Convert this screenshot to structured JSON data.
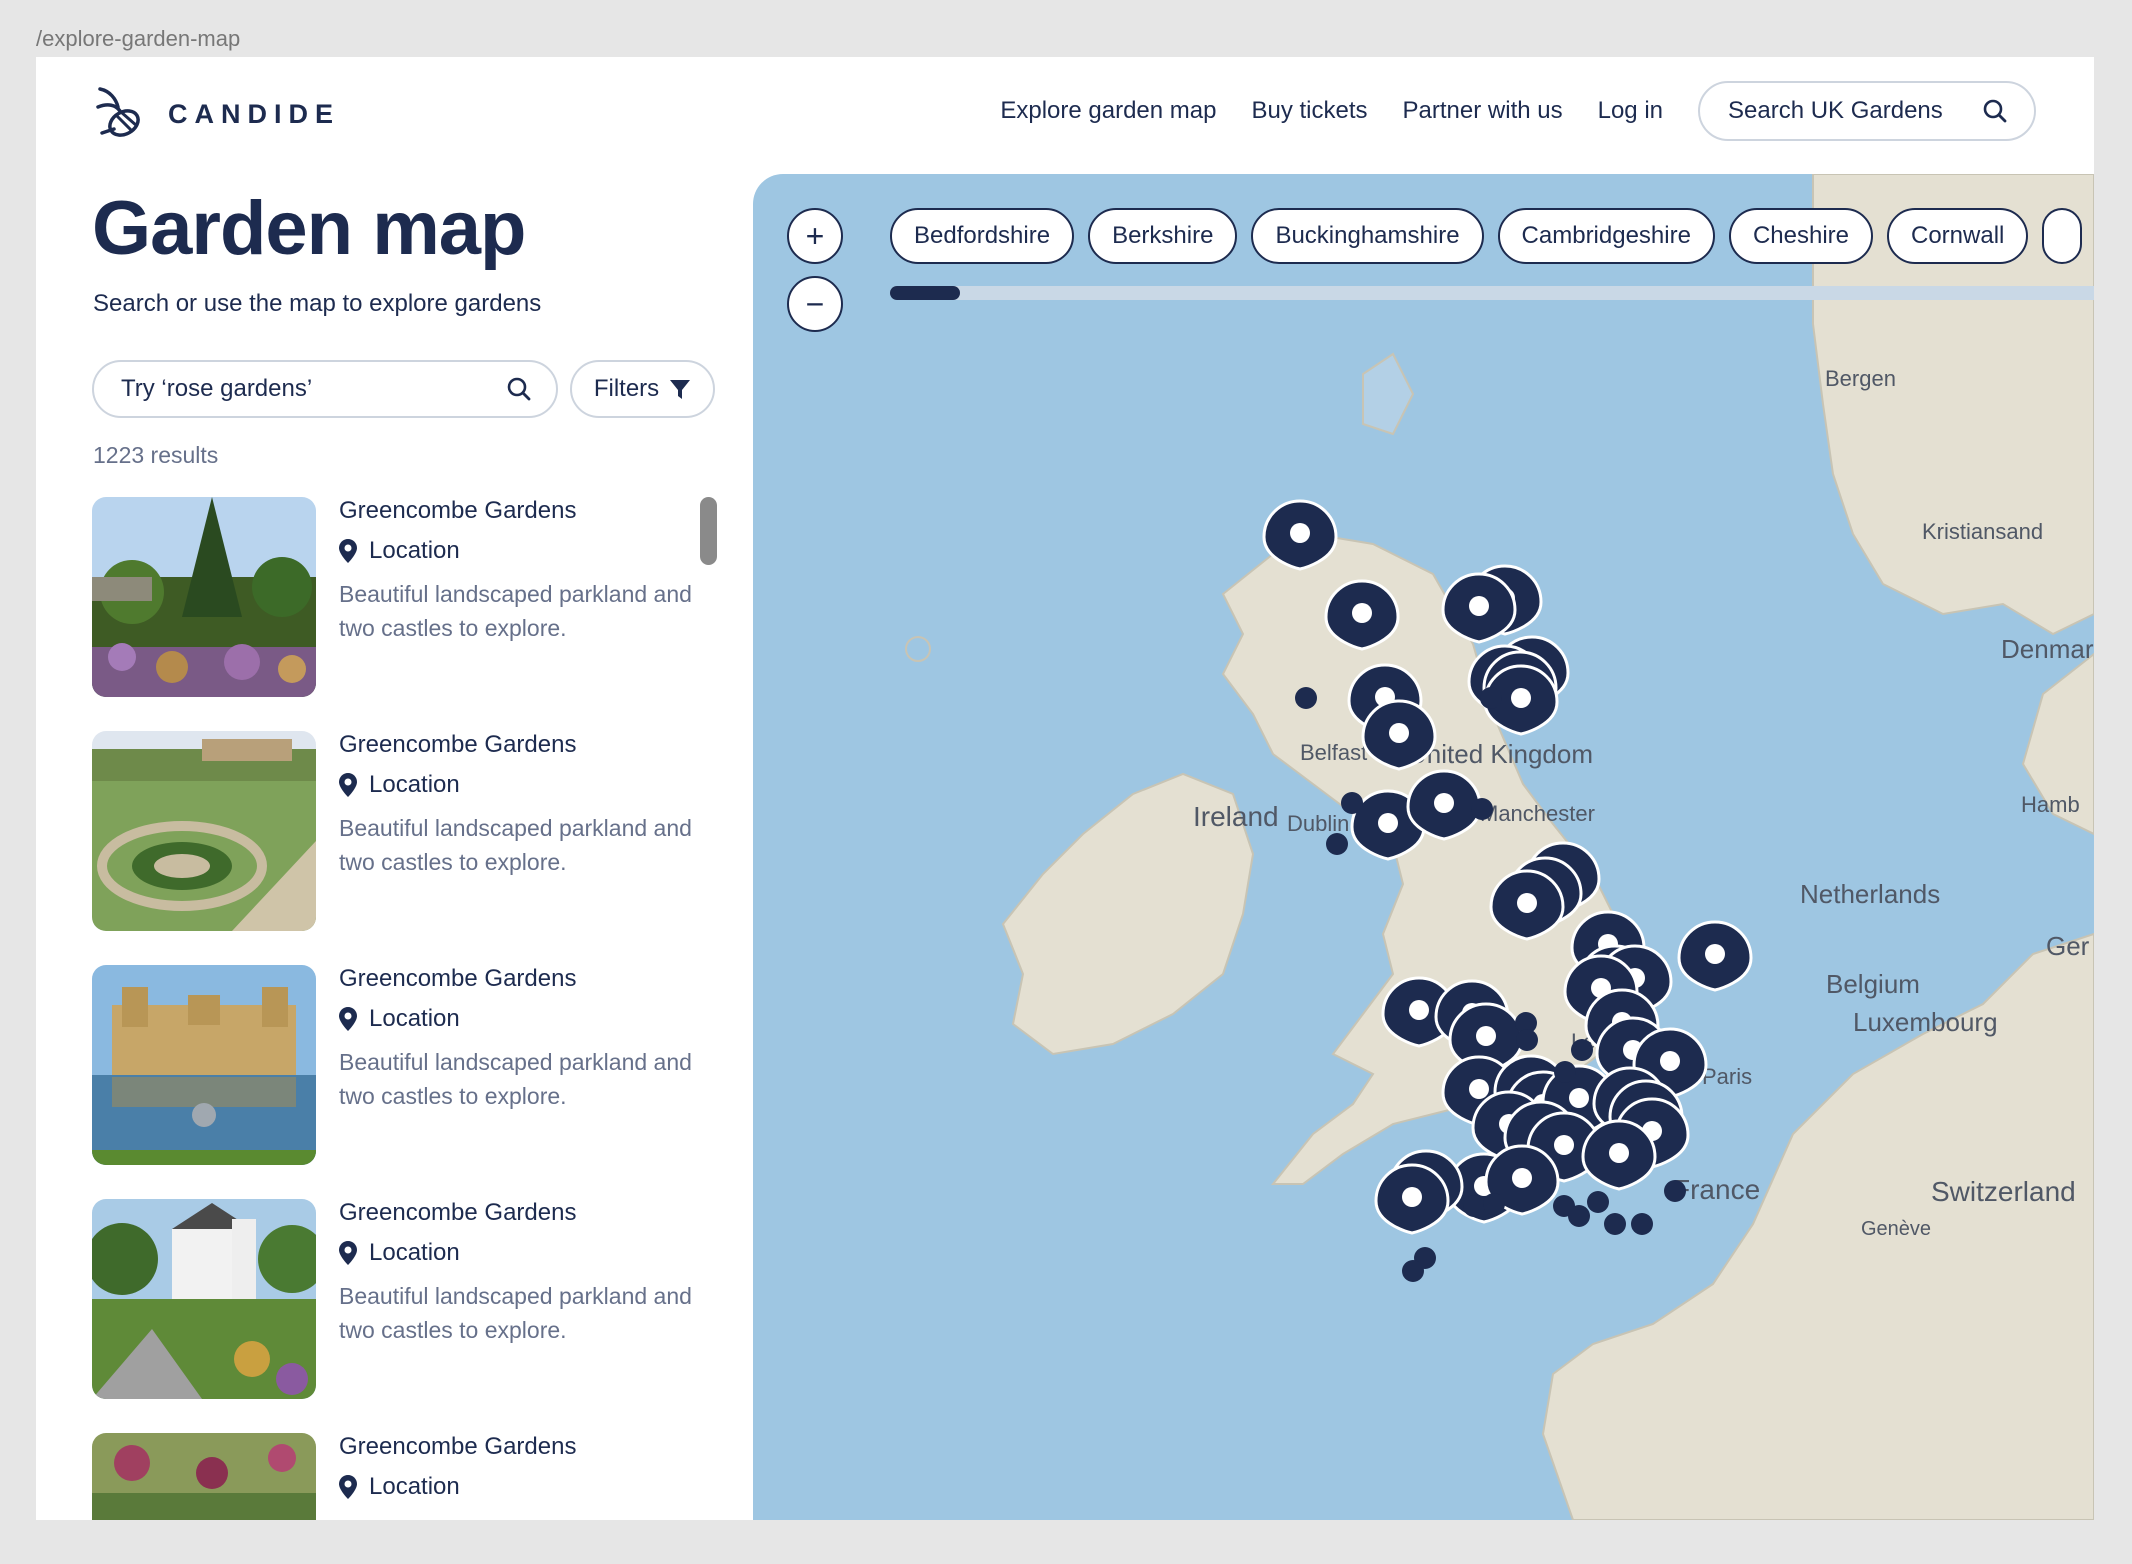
{
  "route": "/explore-garden-map",
  "brand": {
    "name": "CANDIDE"
  },
  "nav": {
    "items": [
      "Explore garden map",
      "Buy tickets",
      "Partner with us",
      "Log in"
    ],
    "search_label": "Search UK Gardens"
  },
  "page": {
    "title": "Garden map",
    "subtitle": "Search or use the map to explore gardens",
    "search_placeholder": "Try ‘rose gardens’",
    "filters_label": "Filters",
    "results_count": "1223 results"
  },
  "gardens": [
    {
      "title": "Greencombe Gardens",
      "location": "Location",
      "description": "Beautiful landscaped parkland and two castles to explore."
    },
    {
      "title": "Greencombe Gardens",
      "location": "Location",
      "description": "Beautiful landscaped parkland and two castles to explore."
    },
    {
      "title": "Greencombe Gardens",
      "location": "Location",
      "description": "Beautiful landscaped parkland and two castles to explore."
    },
    {
      "title": "Greencombe Gardens",
      "location": "Location",
      "description": "Beautiful landscaped parkland and two castles to explore."
    },
    {
      "title": "Greencombe Gardens",
      "location": "Location",
      "description": ""
    }
  ],
  "map": {
    "zoom_in": "+",
    "zoom_out": "−",
    "county_chips": [
      "Bedfordshire",
      "Berkshire",
      "Buckinghamshire",
      "Cambridgeshire",
      "Cheshire",
      "Cornwall"
    ],
    "labels": [
      "Bergen",
      "Kristiansand",
      "Denmar",
      "Hamb",
      "Netherlands",
      "Ger",
      "Belgium",
      "Luxembourg",
      "Le Havre",
      "Paris",
      "France",
      "Switzerland",
      "Genève",
      "Belfast",
      "United Kingdom",
      "Ireland",
      "Dublin",
      "Manchester"
    ]
  },
  "colors": {
    "navy": "#1d2b4f",
    "sea": "#9ec6e2",
    "land": "#e4e0d2",
    "muted_text": "#66708a"
  },
  "icons": [
    "bee-logo-icon",
    "search-icon",
    "filter-icon",
    "location-pin-icon",
    "map-marker-icon"
  ]
}
